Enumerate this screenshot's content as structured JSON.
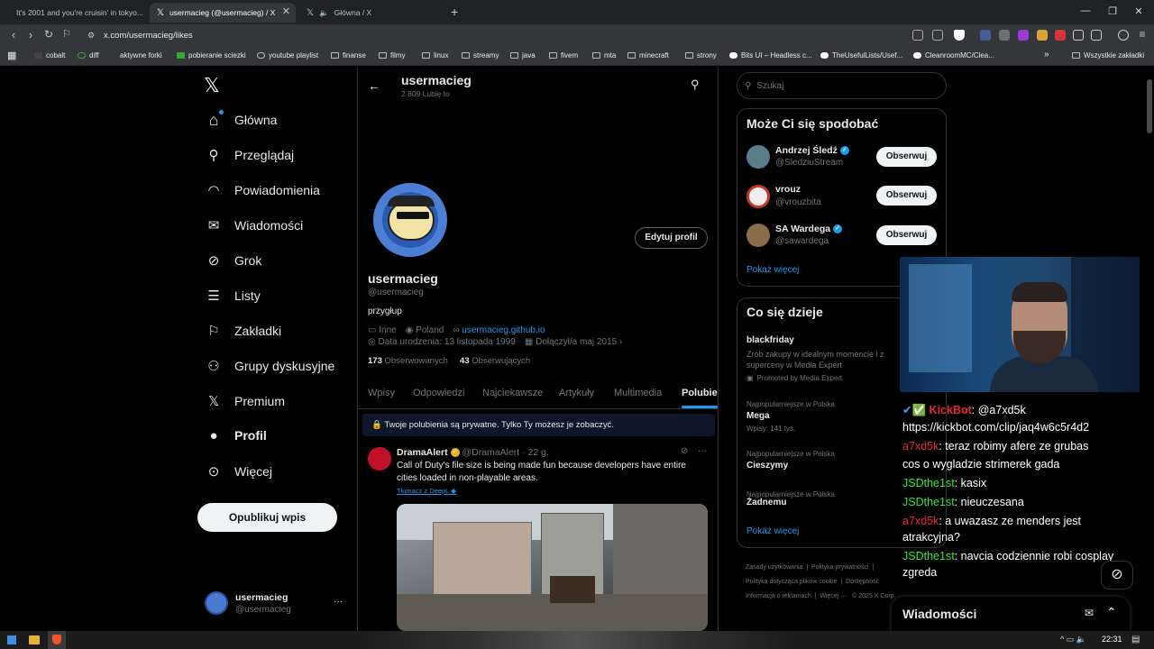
{
  "browser": {
    "tabs": [
      {
        "title": "It's 2001 and you're cruisin' in tokyo..."
      },
      {
        "title": "usermacieg (@usermacieg) / X"
      },
      {
        "title": "Główna / X"
      }
    ],
    "url": "x.com/usermacieg/likes",
    "bookmarks": [
      "cobalt",
      "diff",
      "aktywne forki",
      "pobieranie sciezki",
      "youtube playlist",
      "finanse",
      "filmy",
      "linux",
      "streamy",
      "java",
      "fivem",
      "mta",
      "minecraft",
      "strony",
      "Bits UI – Headless c...",
      "TheUsefulLists/Usef...",
      "CleanroomMC/Clea..."
    ],
    "all_bookmarks": "Wszystkie zakładki"
  },
  "nav": {
    "logo": "𝕏",
    "items": [
      {
        "label": "Główna",
        "icon": "home-icon",
        "glyph": "⌂"
      },
      {
        "label": "Przeglądaj",
        "icon": "search-icon",
        "glyph": "⌕"
      },
      {
        "label": "Powiadomienia",
        "icon": "bell-icon",
        "glyph": "🔔"
      },
      {
        "label": "Wiadomości",
        "icon": "mail-icon",
        "glyph": "✉"
      },
      {
        "label": "Grok",
        "icon": "grok-icon",
        "glyph": "⊘"
      },
      {
        "label": "Listy",
        "icon": "list-icon",
        "glyph": "☰"
      },
      {
        "label": "Zakładki",
        "icon": "bookmark-icon",
        "glyph": "⚑"
      },
      {
        "label": "Grupy dyskusyjne",
        "icon": "community-icon",
        "glyph": "👥"
      },
      {
        "label": "Premium",
        "icon": "premium-icon",
        "glyph": "𝕏"
      },
      {
        "label": "Profil",
        "icon": "profile-icon",
        "glyph": "👤"
      },
      {
        "label": "Więcej",
        "icon": "more-icon",
        "glyph": "⋯"
      }
    ],
    "publish": "Opublikuj wpis",
    "account": {
      "name": "usermacieg",
      "handle": "@usermacieg",
      "more": "···"
    }
  },
  "profile": {
    "header_name": "usermacieg",
    "header_sub": "2 809 Lubię to",
    "name": "usermacieg",
    "handle": "@usermacieg",
    "bio": "przygłup",
    "edit": "Edytuj profil",
    "category": "Inne",
    "location": "Poland",
    "link": "usermacieg.github.io",
    "birth": "Data urodzenia: 13 listopada 1999",
    "joined": "Dołączył/a maj 2015",
    "following_count": "173",
    "following_label": "Obserwowanych",
    "followers_count": "43",
    "followers_label": "Obserwujących",
    "tabs": [
      "Wpisy",
      "Odpowiedzi",
      "Najciekawsze",
      "Artykuły",
      "Multimedia",
      "Polubienia"
    ],
    "privacy_notice": "Twoje polubienia są prywatne. Tylko Ty możesz je zobaczyć."
  },
  "tweet": {
    "author": "DramaAlert",
    "handle": "@DramaAlert",
    "time": "· 22 g.",
    "text": "Call of Duty's file size is being made fun because developers have entire cities loaded in non-playable areas.",
    "translate": "Tłumacz z DeepL",
    "more": "···"
  },
  "search": {
    "placeholder": "Szukaj"
  },
  "suggestions": {
    "title": "Może Ci się spodobać",
    "people": [
      {
        "name": "Andrzej Śledź",
        "handle": "@SledziuStream",
        "verified": true,
        "color": "#5a7d8a"
      },
      {
        "name": "vrouz",
        "handle": "@vrouzbita",
        "verified": false,
        "color": "#c0392b"
      },
      {
        "name": "SA Wardega",
        "handle": "@sawardega",
        "verified": true,
        "color": "#8a6d4a"
      }
    ],
    "follow": "Obserwuj",
    "more": "Pokaż więcej"
  },
  "trends": {
    "title": "Co się dzieje",
    "items": [
      {
        "name": "blackfriday",
        "desc": "Zrób zakupy w idealnym momencie i z superceny w Media Expert",
        "promo": "Promoted by Media Expert"
      },
      {
        "context": "Najpopularniejsze w Polska",
        "name": "Mega",
        "count": "Wpisy: 141 tys."
      },
      {
        "context": "Najpopularniejsze w Polska",
        "name": "Cieszymy"
      },
      {
        "context": "Najpopularniejsze w Polska",
        "name": "Żadnemu"
      }
    ],
    "more": "Pokaż więcej"
  },
  "footer": [
    "Zasady użytkowania",
    "|",
    "Polityka prywatności",
    "|",
    "Polityka dotycząca plików cookie",
    "|",
    "Dostępność",
    "Informacja o reklamach",
    "|",
    "Więcej ···",
    "© 2025 X Corp."
  ],
  "chat": [
    {
      "user": "KickBot",
      "user_color": "#e8293b",
      "text": ": @a7xd5k"
    },
    {
      "user": "",
      "user_color": "#fff",
      "text": "https://kickbot.com/clip/jaq4w6c5r4d2"
    },
    {
      "user": "a7xd5k",
      "user_color": "#e8293b",
      "text": ": teraz robimy afere ze grubas"
    },
    {
      "user": "",
      "user_color": "#fff",
      "text": "cos o wygladzie strimerek gada"
    },
    {
      "user": "JSDthe1st",
      "user_color": "#39e639",
      "text": ": kasix"
    },
    {
      "user": "JSDthe1st",
      "user_color": "#39e639",
      "text": ": nieuczesana"
    },
    {
      "user": "a7xd5k",
      "user_color": "#e8293b",
      "text": ": a uwazasz ze menders jest"
    },
    {
      "user": "",
      "user_color": "#fff",
      "text": "atrakcyjna?"
    },
    {
      "user": "JSDthe1st",
      "user_color": "#39e639",
      "text": ": navcia codziennie robi cosplay"
    },
    {
      "user": "",
      "user_color": "#fff",
      "text": "zgreda"
    }
  ],
  "messages_drawer": {
    "title": "Wiadomości"
  },
  "taskbar": {
    "time": "22:31"
  }
}
